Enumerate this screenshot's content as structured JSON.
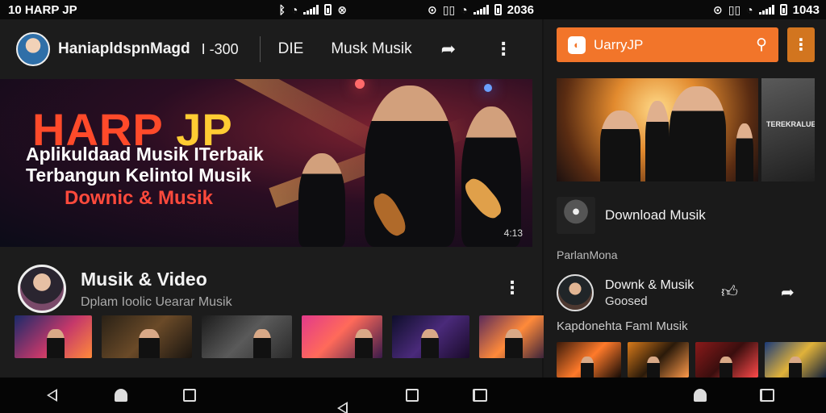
{
  "status_left": {
    "time": "10 HARP JP"
  },
  "status_mid": {
    "time": ""
  },
  "status_right": {
    "time": "1043",
    "mid_time": "2036"
  },
  "left_panel": {
    "topbar": {
      "channel_name": "HaniapldspnMagd",
      "count": "I -300",
      "tab1": "DIE",
      "tab2": "Musk Musik",
      "share_icon": "share-icon",
      "more_icon": "more-vert-icon"
    },
    "hero": {
      "title_red": "HARP",
      "title_yellow": "JP",
      "line1": "Aplikuldaad Musik ITerbaik",
      "line2": "Terbangun Kelintol Musik",
      "line3": "Downic & Musik",
      "badge": "4:13"
    },
    "channel": {
      "title": "Musik & Video",
      "subtitle": "Dplam Ioolic Uearar Musik"
    },
    "thumbnails": [
      {
        "colors": [
          "#1a2a6a",
          "#c5386a",
          "#ff8a3a"
        ]
      },
      {
        "colors": [
          "#2a2116",
          "#6a4a28",
          "#1a1510"
        ]
      },
      {
        "colors": [
          "#1c1c1c",
          "#5a5a5a",
          "#2a2a2a"
        ]
      },
      {
        "colors": [
          "#e23a8a",
          "#ff6a5a",
          "#3a1a4a"
        ]
      },
      {
        "colors": [
          "#0e0e2a",
          "#4a2a7a",
          "#1a0a2a"
        ]
      },
      {
        "colors": [
          "#5a2a5a",
          "#ff8a3a",
          "#2a1a3a"
        ]
      }
    ]
  },
  "right_panel": {
    "search_text": "UarryJP",
    "search_icon": "search-icon",
    "menu_icon": "more-vert-icon",
    "banner_side_text": "TEREKRALUE",
    "download_label": "Download Musik",
    "section1": "ParlanMona",
    "item": {
      "title": "Downk & Musik",
      "subtitle": "Goosed",
      "like_icon": "thumbs-up-icon",
      "share_icon": "share-icon"
    },
    "section2": "Kapdonehta FamI Musik",
    "thumbnails": [
      {
        "colors": [
          "#3a1a0a",
          "#ff7a2a",
          "#120a06"
        ]
      },
      {
        "colors": [
          "#d87a1a",
          "#2a1a0a",
          "#ff9a4a"
        ]
      },
      {
        "colors": [
          "#8a1a1a",
          "#3a0e0e",
          "#ff4a4a"
        ]
      },
      {
        "colors": [
          "#1a3a7a",
          "#e0b23a",
          "#0a1a3a"
        ]
      }
    ]
  },
  "navbar": {
    "left_buttons": [
      "back",
      "home",
      "recents",
      "back",
      "recents",
      "switch"
    ],
    "right_buttons": [
      "back",
      "home",
      "switch"
    ]
  },
  "colors": {
    "accent": "#f2752a",
    "accent_dark": "#d2751f",
    "background": "#141414"
  }
}
